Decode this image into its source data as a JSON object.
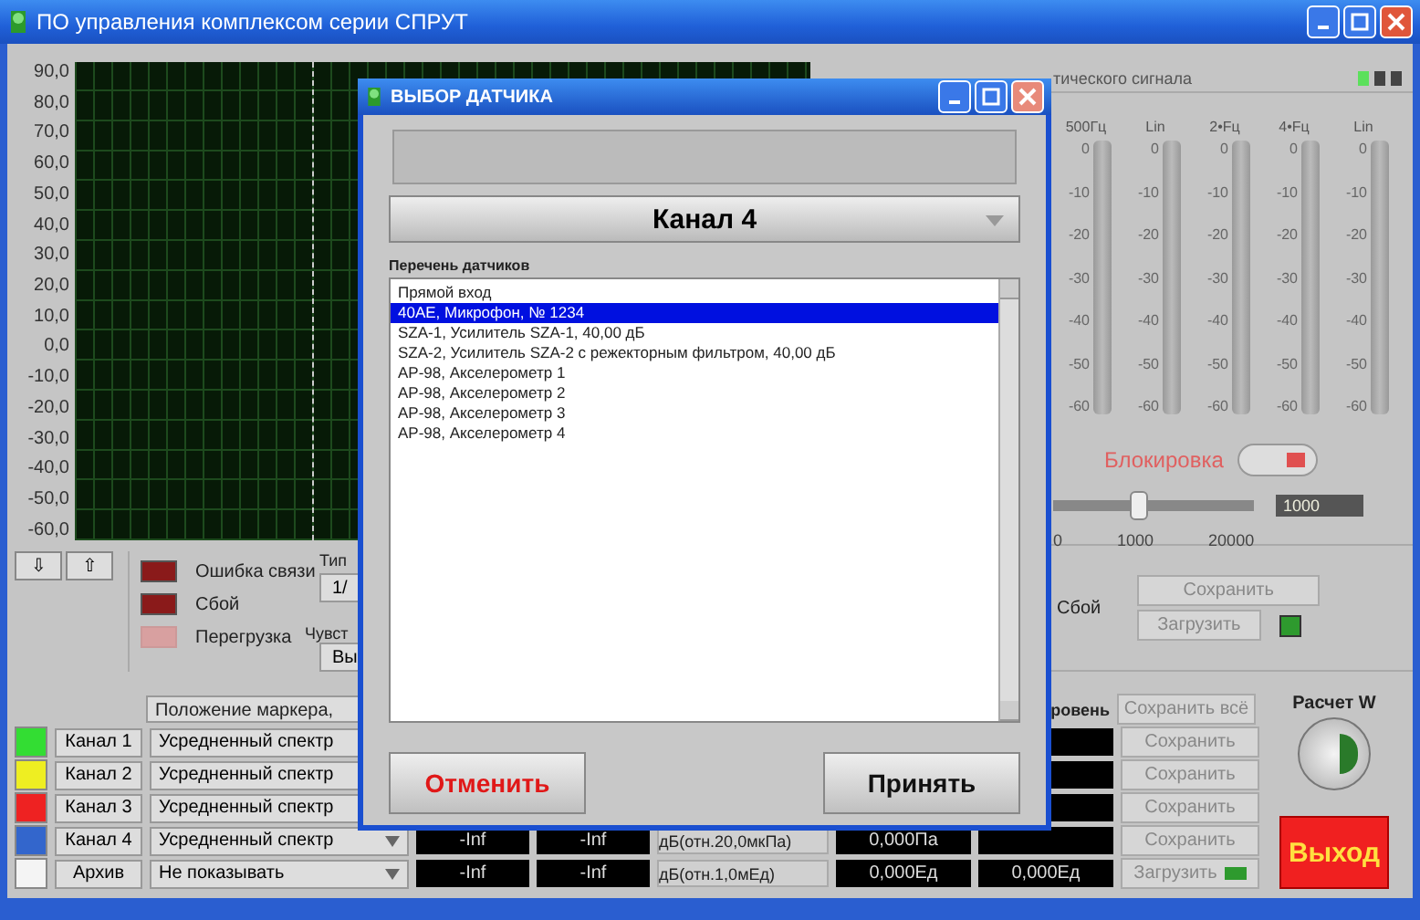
{
  "window": {
    "title": "ПО управления комплексом серии СПРУТ"
  },
  "chart": {
    "y_labels": [
      "90,0",
      "80,0",
      "70,0",
      "60,0",
      "50,0",
      "40,0",
      "30,0",
      "20,0",
      "10,0",
      "0,0",
      "-10,0",
      "-20,0",
      "-30,0",
      "-40,0",
      "-50,0",
      "-60,0"
    ]
  },
  "scroll_buttons": [
    "⇩",
    "⇧"
  ],
  "indicators": [
    {
      "label": "Ошибка связи",
      "on": true
    },
    {
      "label": "Сбой",
      "on": true
    },
    {
      "label": "Перегрузка",
      "on": false
    }
  ],
  "partial_controls": {
    "type_label": "Тип",
    "type_value": "1/",
    "sens_label": "Чувст",
    "sens_value": "Вы"
  },
  "meter_panel": {
    "title": "тического сигнала",
    "leds": [
      {
        "on": true
      },
      {
        "on": false
      },
      {
        "on": false
      }
    ],
    "meters": [
      {
        "header": "500Гц",
        "scale": [
          "0",
          "-10",
          "-20",
          "-30",
          "-40",
          "-50",
          "-60"
        ]
      },
      {
        "header": "Lin",
        "scale": [
          "0",
          "-10",
          "-20",
          "-30",
          "-40",
          "-50",
          "-60"
        ]
      },
      {
        "header": "2•Fц",
        "scale": [
          "0",
          "-10",
          "-20",
          "-30",
          "-40",
          "-50",
          "-60"
        ]
      },
      {
        "header": "4•Fц",
        "scale": [
          "0",
          "-10",
          "-20",
          "-30",
          "-40",
          "-50",
          "-60"
        ]
      },
      {
        "header": "Lin",
        "scale": [
          "0",
          "-10",
          "-20",
          "-30",
          "-40",
          "-50",
          "-60"
        ]
      }
    ],
    "lock_label": "Блокировка",
    "lock_on": true,
    "slider": {
      "level": 0.42,
      "value": "1000",
      "ticks": [
        "0",
        "1000",
        "20000"
      ]
    },
    "fault_label": "Сбой",
    "save": "Сохранить",
    "load": "Загрузить",
    "load_led": true
  },
  "table": {
    "header_marker": "Положение маркера,",
    "header_level": "ровень",
    "save_all": "Сохранить всё",
    "rows": [
      {
        "color": "#33dd33",
        "name": "Канал 1",
        "mode": "Усредненный спектр",
        "action": "Сохранить"
      },
      {
        "color": "#eeee22",
        "name": "Канал 2",
        "mode": "Усредненный спектр",
        "action": "Сохранить"
      },
      {
        "color": "#ee2222",
        "name": "Канал 3",
        "mode": "Усредненный спектр",
        "action": "Сохранить"
      },
      {
        "color": "#3366cc",
        "name": "Канал 4",
        "mode": "Усредненный спектр",
        "readouts": [
          "-Inf",
          "-Inf"
        ],
        "unit": "дБ(отн.20,0мкПа)",
        "value_1": "0,000Па",
        "action": "Сохранить"
      },
      {
        "color": "#f4f4f4",
        "name": "Архив",
        "mode": "Не показывать",
        "readouts": [
          "-Inf",
          "-Inf"
        ],
        "unit": "дБ(отн.1,0мЕд)",
        "value_1": "0,000Eд",
        "value_2": "0,000Eд",
        "action": "Загрузить",
        "led": true
      }
    ]
  },
  "calc": {
    "label": "Расчет W"
  },
  "exit": {
    "label": "Выход"
  },
  "dialog": {
    "title": "ВЫБОР ДАТЧИКА",
    "channel": "Канал 4",
    "list_label": "Перечень датчиков",
    "sensors": [
      {
        "label": "Прямой вход",
        "selected": false
      },
      {
        "label": "40AE, Микрофон, № 1234",
        "selected": true
      },
      {
        "label": "SZA-1, Усилитель SZA-1, 40,00 дБ",
        "selected": false
      },
      {
        "label": "SZA-2, Усилитель SZA-2 с режекторным фильтром, 40,00 дБ",
        "selected": false
      },
      {
        "label": "AP-98, Акселерометр 1",
        "selected": false
      },
      {
        "label": "AP-98, Акселерометр 2",
        "selected": false
      },
      {
        "label": "AP-98, Акселерометр 3",
        "selected": false
      },
      {
        "label": "AP-98, Акселерометр 4",
        "selected": false
      }
    ],
    "buttons": [
      {
        "label": "Отменить",
        "kind": "cancel"
      },
      {
        "label": "Принять",
        "kind": "accept"
      }
    ]
  }
}
